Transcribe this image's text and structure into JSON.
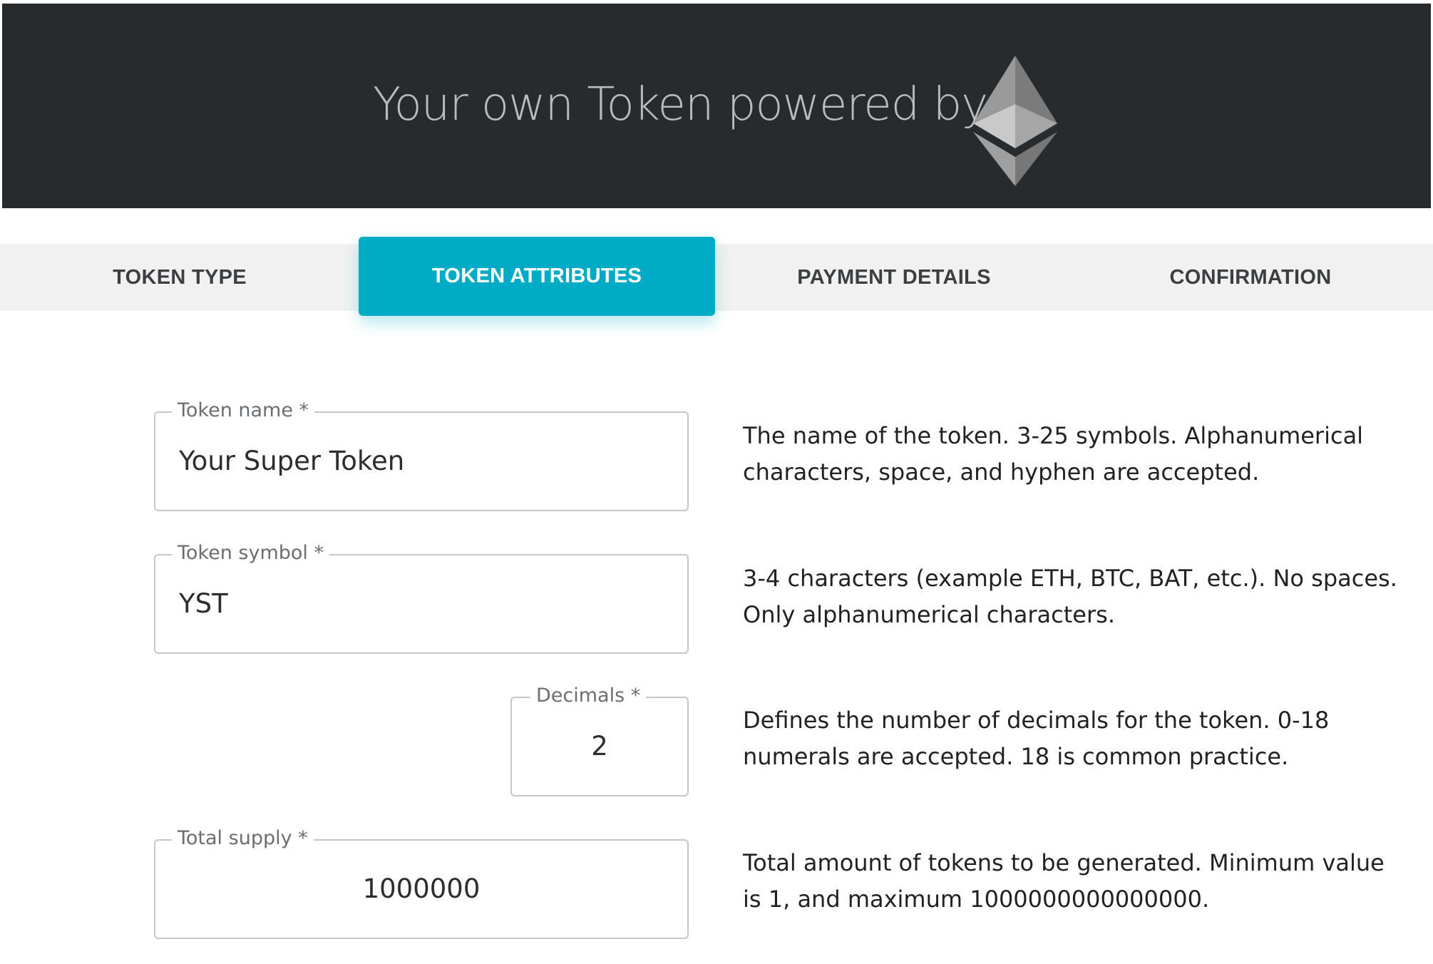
{
  "header": {
    "title": "Your own Token powered by",
    "logo_icon": "ethereum-logo-icon"
  },
  "stepper": {
    "steps": [
      {
        "label": "TOKEN TYPE",
        "active": false
      },
      {
        "label": "TOKEN ATTRIBUTES",
        "active": true
      },
      {
        "label": "PAYMENT DETAILS",
        "active": false
      },
      {
        "label": "CONFIRMATION",
        "active": false
      }
    ]
  },
  "form": {
    "token_name": {
      "label": "Token name *",
      "value": "Your Super Token",
      "help": "The name of the token. 3-25 symbols. Alphanumerical characters, space, and hyphen are accepted."
    },
    "token_symbol": {
      "label": "Token symbol *",
      "value": "YST",
      "help": "3-4 characters (example ETH, BTC, BAT, etc.). No spaces. Only alphanumerical characters."
    },
    "decimals": {
      "label": "Decimals *",
      "value": "2",
      "help": "Defines the number of decimals for the token. 0-18 numerals are accepted. 18 is common practice."
    },
    "total_supply": {
      "label": "Total supply *",
      "value": "1000000",
      "help": "Total amount of tokens to be generated. Minimum value is 1, and maximum 1000000000000000."
    }
  },
  "colors": {
    "header_bg": "#282b2e",
    "accent": "#00acc5",
    "stepper_bg": "#f1f1f1"
  }
}
